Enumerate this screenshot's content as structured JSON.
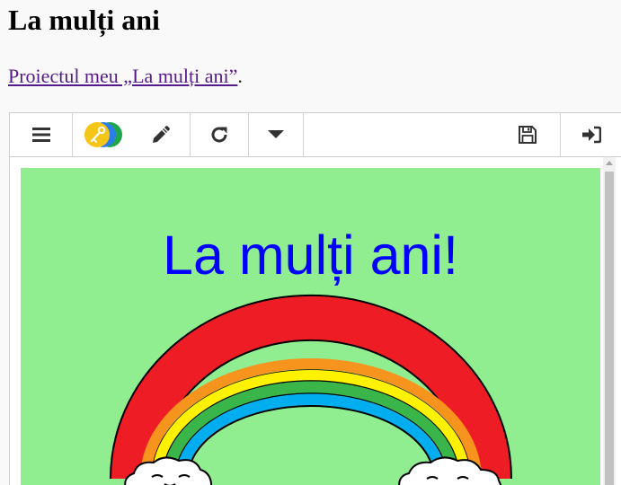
{
  "page": {
    "title": "La mulți ani",
    "intro_link": "Proiectul meu „La mulți ani”",
    "intro_suffix": "."
  },
  "toolbar": {
    "icons": [
      "menu-icon",
      "key-toggle-icon",
      "pencil-icon",
      "reload-icon",
      "caret-down-icon",
      "save-icon",
      "sign-in-icon"
    ]
  },
  "project": {
    "greeting": "La mulți ani!",
    "background_color": "#90ee90",
    "text_color": "#0000ff"
  }
}
